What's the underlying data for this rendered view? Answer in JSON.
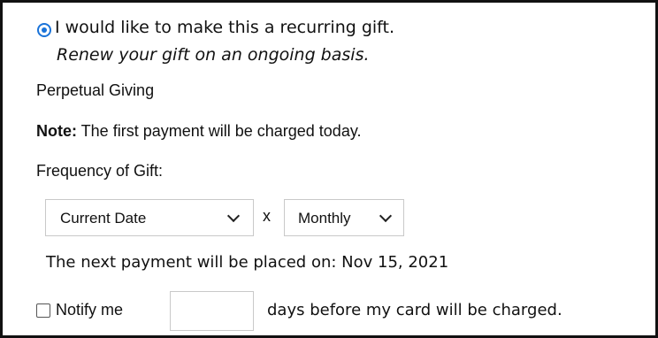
{
  "recurring": {
    "radio_checked": true,
    "label": "I would like to make this a recurring gift.",
    "sublabel": "Renew your gift on an ongoing basis."
  },
  "program": {
    "name": "Perpetual Giving"
  },
  "note": {
    "bold": "Note:",
    "text": " The first payment will be charged today."
  },
  "frequency": {
    "label": "Frequency of Gift:",
    "start_select": {
      "value": "Current Date"
    },
    "separator": "x",
    "interval_select": {
      "value": "Monthly"
    }
  },
  "next_payment": {
    "text": "The next payment will be placed on: Nov 15, 2021"
  },
  "notify": {
    "checked": false,
    "label": "Notify me",
    "days_value": "",
    "suffix": "days before my card will be charged."
  },
  "colors": {
    "radio_accent": "#1a73d9",
    "frame_border": "#111111",
    "control_border": "#c9c9c9"
  }
}
